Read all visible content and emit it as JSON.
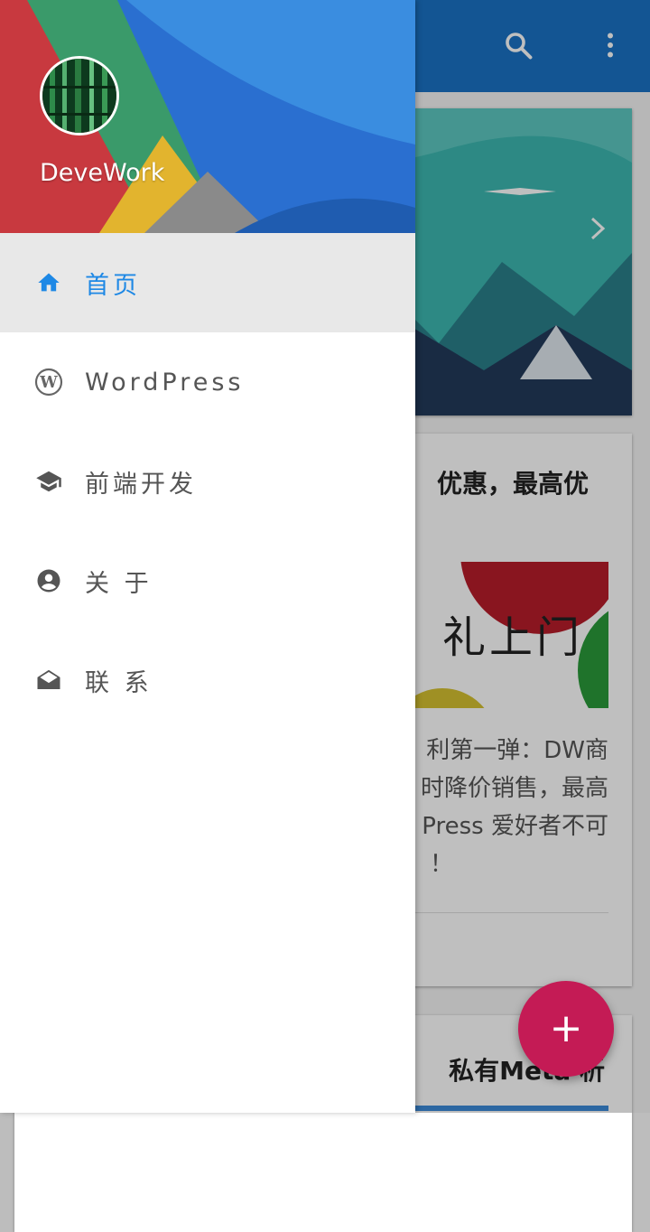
{
  "app": {
    "search_icon": "search-icon",
    "more_icon": "more-vert-icon"
  },
  "drawer": {
    "username": "DeveWork",
    "items": [
      {
        "label": "首页",
        "icon": "home-icon",
        "active": true
      },
      {
        "label": "WordPress",
        "icon": "wordpress-icon",
        "active": false
      },
      {
        "label": "前端开发",
        "icon": "school-icon",
        "active": false
      },
      {
        "label": "关 于",
        "icon": "account-circle-icon",
        "active": false
      },
      {
        "label": "联 系",
        "icon": "drafts-icon",
        "active": false
      }
    ]
  },
  "feed": {
    "post1": {
      "title": "优惠，最高优",
      "image_text": "礼上门",
      "excerpt_lines": [
        "利第一弹：DW商",
        "时降价销售，最高",
        "Press 爱好者不可",
        "！"
      ]
    },
    "post2": {
      "title": "私有Meta 析"
    }
  },
  "fab": {
    "label": "+"
  },
  "colors": {
    "primary": "#1a72c4",
    "accent": "#c41b55",
    "active_text": "#1e88e5"
  }
}
